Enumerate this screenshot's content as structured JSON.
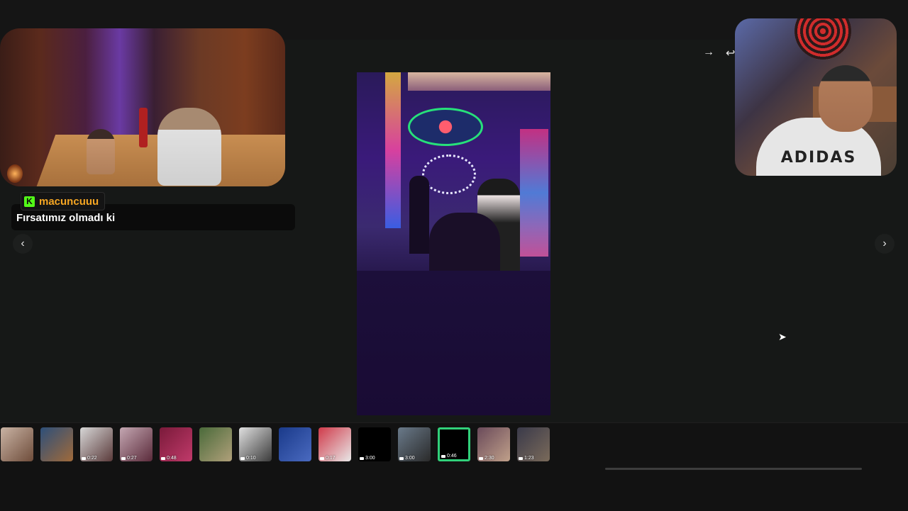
{
  "chat": {
    "username": "macuncuuu",
    "message": "Fırsatımız olmadı ki",
    "platform_icon": "kick-icon",
    "username_color": "#f5a623",
    "badge_color": "#53fc18"
  },
  "navigation": {
    "prev_icon": "chevron-left-icon",
    "next_icon": "chevron-right-icon",
    "share_icon": "arrow-right-icon",
    "reply_icon": "arrow-left-icon"
  },
  "thumbnails": [
    {
      "duration": "",
      "bg": "linear-gradient(135deg,#c9b3a4,#6e4c3a)"
    },
    {
      "duration": "",
      "bg": "linear-gradient(135deg,#2d4f7a,#a06a3a)"
    },
    {
      "duration": "0:22",
      "bg": "linear-gradient(135deg,#d7d7d7,#5a3a3a)"
    },
    {
      "duration": "0:27",
      "bg": "linear-gradient(135deg,#c4a7b2,#5a2a3a)"
    },
    {
      "duration": "0:48",
      "bg": "linear-gradient(135deg,#7a1a3a,#c03a6a)"
    },
    {
      "duration": "",
      "bg": "linear-gradient(135deg,#4a6a3a,#b0a07a)"
    },
    {
      "duration": "0:10",
      "bg": "linear-gradient(135deg,#e0e0e0,#3a3a3a)"
    },
    {
      "duration": "",
      "bg": "linear-gradient(135deg,#1a3a8a,#4a6ac0)"
    },
    {
      "duration": "0:17",
      "bg": "linear-gradient(135deg,#d03a4a,#e8e8e8)"
    },
    {
      "duration": "3:00",
      "bg": "#000000"
    },
    {
      "duration": "3:00",
      "bg": "linear-gradient(135deg,#6a7a8a,#2a2a2a)"
    },
    {
      "duration": "0:46",
      "bg": "#000000",
      "selected": true
    },
    {
      "duration": "2:30",
      "bg": "linear-gradient(135deg,#6a4a5a,#c0a08a)"
    },
    {
      "duration": "1:23",
      "bg": "linear-gradient(135deg,#3a3a4a,#7a6a5a)"
    }
  ],
  "colors": {
    "selected_border": "#31d07a",
    "background": "#161817"
  }
}
